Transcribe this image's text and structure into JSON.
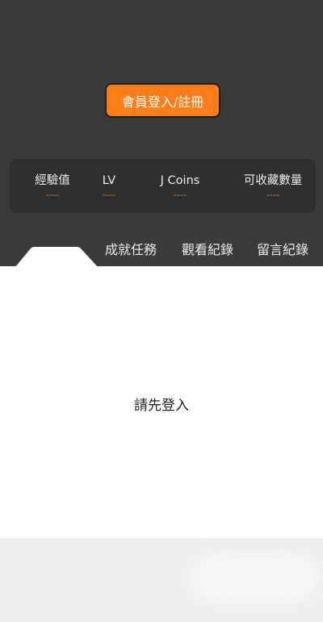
{
  "login": {
    "label": "會員登入/註冊"
  },
  "stats": [
    {
      "label": "經驗值",
      "value": "----"
    },
    {
      "label": "LV",
      "value": "----"
    },
    {
      "label": "J Coins",
      "value": "----"
    },
    {
      "label": "可收藏數量",
      "value": "----"
    }
  ],
  "tabs": [
    {
      "label": "成就任務"
    },
    {
      "label": "觀看紀錄"
    },
    {
      "label": "留言紀錄"
    }
  ],
  "content": {
    "message": "請先登入"
  },
  "colors": {
    "header_bg": "#3b3b3d",
    "accent": "#fb7d18",
    "stat_value": "#ee8a2a"
  }
}
